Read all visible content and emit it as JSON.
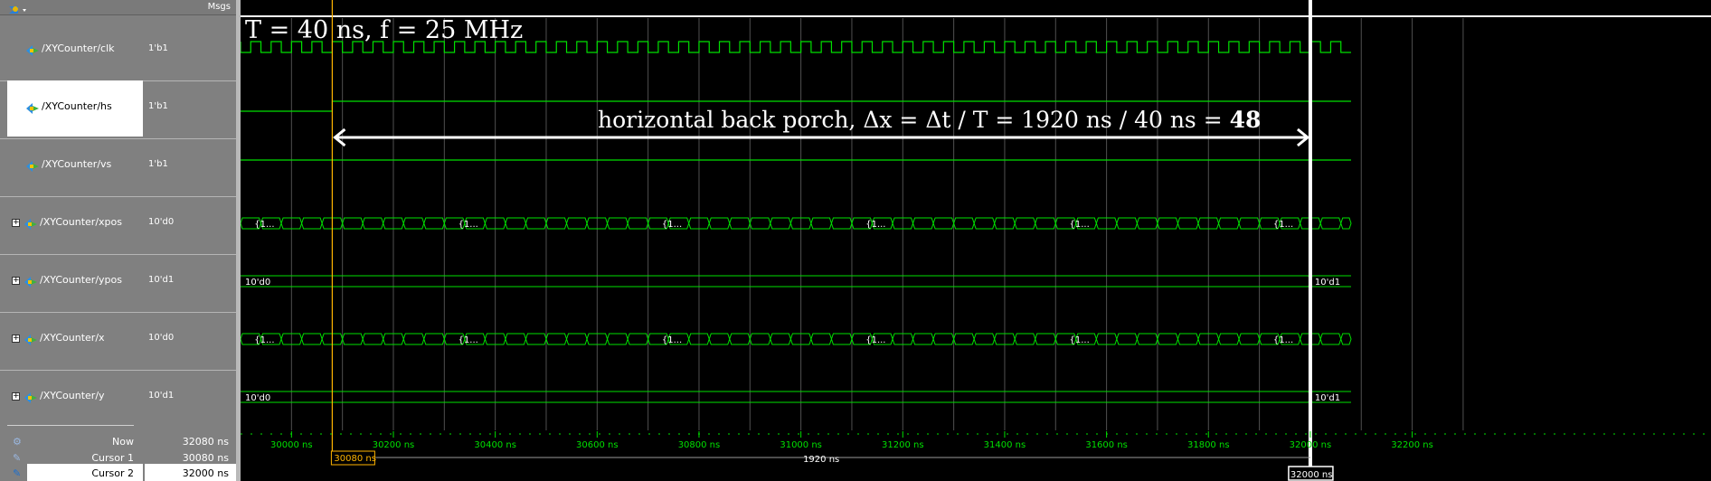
{
  "header": {
    "msgs_label": "Msgs"
  },
  "signals": [
    {
      "name": "/XYCounter/clk",
      "value": "1'b1",
      "expandable": false,
      "selected": false
    },
    {
      "name": "/XYCounter/hs",
      "value": "1'b1",
      "expandable": false,
      "selected": true
    },
    {
      "name": "/XYCounter/vs",
      "value": "1'b1",
      "expandable": false,
      "selected": false
    },
    {
      "name": "/XYCounter/xpos",
      "value": "10'd0",
      "expandable": true,
      "selected": false
    },
    {
      "name": "/XYCounter/ypos",
      "value": "10'd1",
      "expandable": true,
      "selected": false
    },
    {
      "name": "/XYCounter/x",
      "value": "10'd0",
      "expandable": true,
      "selected": false
    },
    {
      "name": "/XYCounter/y",
      "value": "10'd1",
      "expandable": true,
      "selected": false
    }
  ],
  "footer": {
    "now": {
      "label": "Now",
      "value": "32080 ns"
    },
    "cursor1": {
      "label": "Cursor 1",
      "value": "30080 ns"
    },
    "cursor2": {
      "label": "Cursor 2",
      "value": "32000 ns"
    }
  },
  "waveform": {
    "time_start_ns": 29900,
    "time_end_ns": 32300,
    "signal_end_ns": 32080,
    "clock_period_ns": 40,
    "hs_rise_ns": 30080,
    "cursor1_ns": 30080,
    "cursor2_ns": 32000,
    "tick_step_ns": 200,
    "tick_labels": [
      "30000 ns",
      "30200 ns",
      "30400 ns",
      "30600 ns",
      "30800 ns",
      "31000 ns",
      "31200 ns",
      "31400 ns",
      "31600 ns",
      "31800 ns",
      "32000 ns",
      "32200 ns"
    ],
    "bus_group_label": "{1...",
    "ypos_before": "10'd0",
    "ypos_after": "10'd1",
    "y_before": "10'd0",
    "y_after": "10'd1",
    "cursor1_label": "30080 ns",
    "cursor2_label": "32000 ns",
    "delta_label": "1920 ns",
    "colors": {
      "signal": "#00e000",
      "cursor1": "#ffb400",
      "cursor2": "#ffffff",
      "grid": "#505050",
      "tick": "#00e000"
    }
  },
  "annotations": {
    "period": "T = 40 ns, f = 25 MHz",
    "back_porch_text": "horizontal back porch, Δx = Δt / T = 1920 ns / 40 ns = ",
    "back_porch_value": "48"
  }
}
